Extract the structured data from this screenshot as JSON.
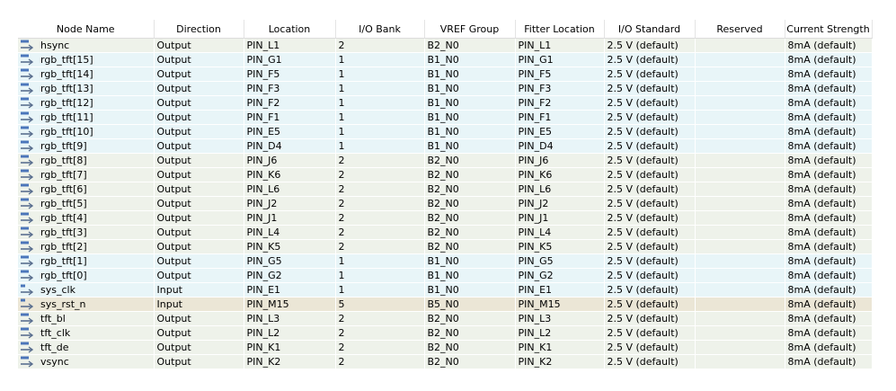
{
  "columns": [
    "Node Name",
    "Direction",
    "Location",
    "I/O Bank",
    "VREF Group",
    "Fitter Location",
    "I/O Standard",
    "Reserved",
    "Current Strength"
  ],
  "rows": [
    {
      "name": "hsync",
      "direction": "Output",
      "location": "PIN_L1",
      "bank": "2",
      "vref": "B2_N0",
      "fitter": "PIN_L1",
      "standard": "2.5 V (default)",
      "reserved": "",
      "strength": "8mA (default)",
      "icon": "out"
    },
    {
      "name": "rgb_tft[15]",
      "direction": "Output",
      "location": "PIN_G1",
      "bank": "1",
      "vref": "B1_N0",
      "fitter": "PIN_G1",
      "standard": "2.5 V (default)",
      "reserved": "",
      "strength": "8mA (default)",
      "icon": "out"
    },
    {
      "name": "rgb_tft[14]",
      "direction": "Output",
      "location": "PIN_F5",
      "bank": "1",
      "vref": "B1_N0",
      "fitter": "PIN_F5",
      "standard": "2.5 V (default)",
      "reserved": "",
      "strength": "8mA (default)",
      "icon": "out"
    },
    {
      "name": "rgb_tft[13]",
      "direction": "Output",
      "location": "PIN_F3",
      "bank": "1",
      "vref": "B1_N0",
      "fitter": "PIN_F3",
      "standard": "2.5 V (default)",
      "reserved": "",
      "strength": "8mA (default)",
      "icon": "out"
    },
    {
      "name": "rgb_tft[12]",
      "direction": "Output",
      "location": "PIN_F2",
      "bank": "1",
      "vref": "B1_N0",
      "fitter": "PIN_F2",
      "standard": "2.5 V (default)",
      "reserved": "",
      "strength": "8mA (default)",
      "icon": "out"
    },
    {
      "name": "rgb_tft[11]",
      "direction": "Output",
      "location": "PIN_F1",
      "bank": "1",
      "vref": "B1_N0",
      "fitter": "PIN_F1",
      "standard": "2.5 V (default)",
      "reserved": "",
      "strength": "8mA (default)",
      "icon": "out"
    },
    {
      "name": "rgb_tft[10]",
      "direction": "Output",
      "location": "PIN_E5",
      "bank": "1",
      "vref": "B1_N0",
      "fitter": "PIN_E5",
      "standard": "2.5 V (default)",
      "reserved": "",
      "strength": "8mA (default)",
      "icon": "out"
    },
    {
      "name": "rgb_tft[9]",
      "direction": "Output",
      "location": "PIN_D4",
      "bank": "1",
      "vref": "B1_N0",
      "fitter": "PIN_D4",
      "standard": "2.5 V (default)",
      "reserved": "",
      "strength": "8mA (default)",
      "icon": "out"
    },
    {
      "name": "rgb_tft[8]",
      "direction": "Output",
      "location": "PIN_J6",
      "bank": "2",
      "vref": "B2_N0",
      "fitter": "PIN_J6",
      "standard": "2.5 V (default)",
      "reserved": "",
      "strength": "8mA (default)",
      "icon": "out"
    },
    {
      "name": "rgb_tft[7]",
      "direction": "Output",
      "location": "PIN_K6",
      "bank": "2",
      "vref": "B2_N0",
      "fitter": "PIN_K6",
      "standard": "2.5 V (default)",
      "reserved": "",
      "strength": "8mA (default)",
      "icon": "out"
    },
    {
      "name": "rgb_tft[6]",
      "direction": "Output",
      "location": "PIN_L6",
      "bank": "2",
      "vref": "B2_N0",
      "fitter": "PIN_L6",
      "standard": "2.5 V (default)",
      "reserved": "",
      "strength": "8mA (default)",
      "icon": "out"
    },
    {
      "name": "rgb_tft[5]",
      "direction": "Output",
      "location": "PIN_J2",
      "bank": "2",
      "vref": "B2_N0",
      "fitter": "PIN_J2",
      "standard": "2.5 V (default)",
      "reserved": "",
      "strength": "8mA (default)",
      "icon": "out"
    },
    {
      "name": "rgb_tft[4]",
      "direction": "Output",
      "location": "PIN_J1",
      "bank": "2",
      "vref": "B2_N0",
      "fitter": "PIN_J1",
      "standard": "2.5 V (default)",
      "reserved": "",
      "strength": "8mA (default)",
      "icon": "out"
    },
    {
      "name": "rgb_tft[3]",
      "direction": "Output",
      "location": "PIN_L4",
      "bank": "2",
      "vref": "B2_N0",
      "fitter": "PIN_L4",
      "standard": "2.5 V (default)",
      "reserved": "",
      "strength": "8mA (default)",
      "icon": "out"
    },
    {
      "name": "rgb_tft[2]",
      "direction": "Output",
      "location": "PIN_K5",
      "bank": "2",
      "vref": "B2_N0",
      "fitter": "PIN_K5",
      "standard": "2.5 V (default)",
      "reserved": "",
      "strength": "8mA (default)",
      "icon": "out"
    },
    {
      "name": "rgb_tft[1]",
      "direction": "Output",
      "location": "PIN_G5",
      "bank": "1",
      "vref": "B1_N0",
      "fitter": "PIN_G5",
      "standard": "2.5 V (default)",
      "reserved": "",
      "strength": "8mA (default)",
      "icon": "out"
    },
    {
      "name": "rgb_tft[0]",
      "direction": "Output",
      "location": "PIN_G2",
      "bank": "1",
      "vref": "B1_N0",
      "fitter": "PIN_G2",
      "standard": "2.5 V (default)",
      "reserved": "",
      "strength": "8mA (default)",
      "icon": "out"
    },
    {
      "name": "sys_clk",
      "direction": "Input",
      "location": "PIN_E1",
      "bank": "1",
      "vref": "B1_N0",
      "fitter": "PIN_E1",
      "standard": "2.5 V (default)",
      "reserved": "",
      "strength": "8mA (default)",
      "icon": "in"
    },
    {
      "name": "sys_rst_n",
      "direction": "Input",
      "location": "PIN_M15",
      "bank": "5",
      "vref": "B5_N0",
      "fitter": "PIN_M15",
      "standard": "2.5 V (default)",
      "reserved": "",
      "strength": "8mA (default)",
      "icon": "in"
    },
    {
      "name": "tft_bl",
      "direction": "Output",
      "location": "PIN_L3",
      "bank": "2",
      "vref": "B2_N0",
      "fitter": "PIN_L3",
      "standard": "2.5 V (default)",
      "reserved": "",
      "strength": "8mA (default)",
      "icon": "out"
    },
    {
      "name": "tft_clk",
      "direction": "Output",
      "location": "PIN_L2",
      "bank": "2",
      "vref": "B2_N0",
      "fitter": "PIN_L2",
      "standard": "2.5 V (default)",
      "reserved": "",
      "strength": "8mA (default)",
      "icon": "out"
    },
    {
      "name": "tft_de",
      "direction": "Output",
      "location": "PIN_K1",
      "bank": "2",
      "vref": "B2_N0",
      "fitter": "PIN_K1",
      "standard": "2.5 V (default)",
      "reserved": "",
      "strength": "8mA (default)",
      "icon": "out"
    },
    {
      "name": "vsync",
      "direction": "Output",
      "location": "PIN_K2",
      "bank": "2",
      "vref": "B2_N0",
      "fitter": "PIN_K2",
      "standard": "2.5 V (default)",
      "reserved": "",
      "strength": "8mA (default)",
      "icon": "out"
    }
  ],
  "colors": {
    "row_bank1": "#e8f5f8",
    "row_other": "#eef2ea",
    "row_bank5": "#ebe6d6",
    "icon_blue": "#2f5fb0",
    "icon_arrow": "#5a6f8f"
  }
}
